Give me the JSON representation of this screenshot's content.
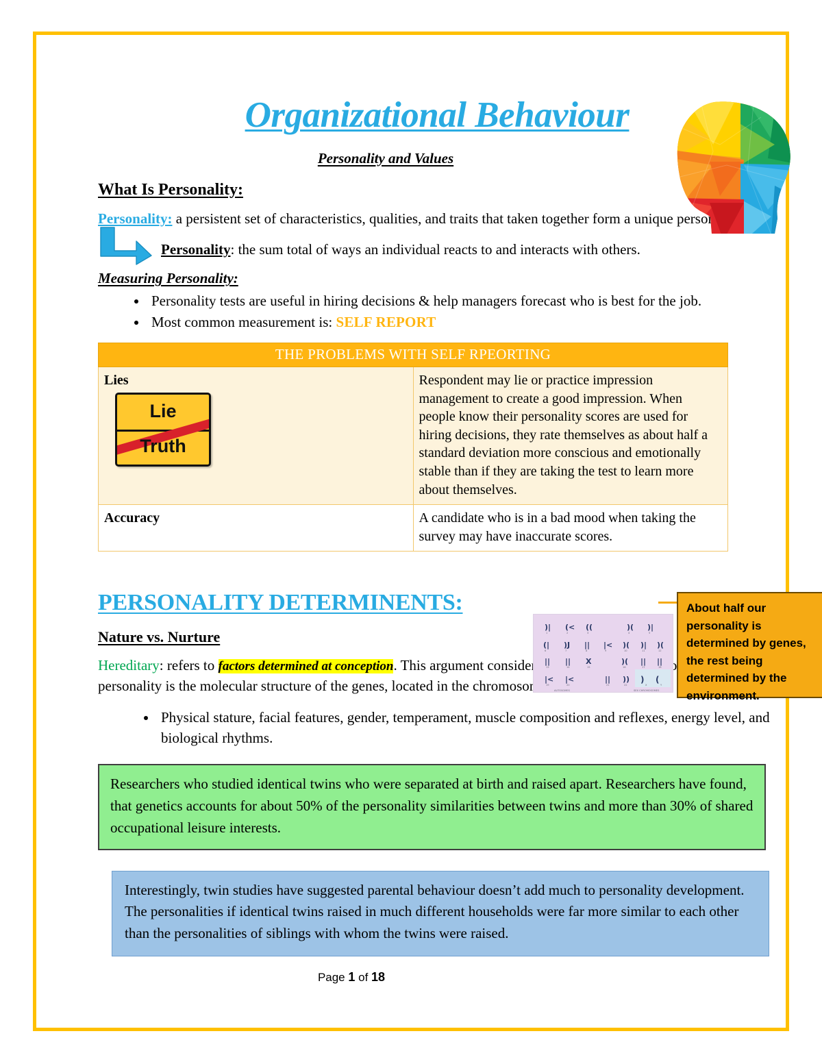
{
  "document": {
    "title": "Organizational Behaviour",
    "subtitle": "Personality and Values",
    "footer_prefix": "Page ",
    "footer_page": "1",
    "footer_middle": " of ",
    "footer_total": "18"
  },
  "colors": {
    "page_border": "#FFC000",
    "title_blue": "#29ABE2",
    "accent_amber": "#FFB511",
    "highlight_yellow": "#FFFF00",
    "green_text": "#00A651",
    "green_box": "#90EE90",
    "blue_box": "#9DC3E6",
    "callout_orange": "#F5AA14",
    "table_header": "#FFB511",
    "table_row_cream": "#FDF3DC"
  },
  "section_personality": {
    "heading": "What Is Personality:",
    "definition_term": "Personality:",
    "definition_text": " a persistent set of characteristics, qualities, and traits that taken together form a unique person.",
    "arrow_term": "Personality",
    "arrow_text": ": the sum total of ways an individual reacts to and interacts with others.",
    "measuring_heading": "Measuring Personality:",
    "bullets": [
      "Personality tests are useful in hiring decisions & help managers forecast who is best for the job."
    ],
    "bullet2_prefix": "Most common measurement is: ",
    "bullet2_emphasis": "SELF REPORT"
  },
  "table_problems": {
    "header": "THE PROBLEMS WITH SELF RPEORTING",
    "rows": [
      {
        "label": "Lies",
        "sign_top": "Lie",
        "sign_bottom": "Truth",
        "body": "Respondent may lie or practice impression management to create a good impression. When people know their personality scores are used for hiring decisions, they rate themselves as about half a standard deviation more conscious and emotionally stable than if they are taking the test to learn more about themselves."
      },
      {
        "label": "Accuracy",
        "body": "A candidate who is in a bad mood when taking the survey may have inaccurate scores."
      }
    ]
  },
  "section_determinants": {
    "heading": "PERSONALITY DETERMINENTS:",
    "nature_heading": "Nature vs. Nurture",
    "hereditary_term": "Hereditary",
    "hereditary_mid": ": refers to ",
    "hereditary_highlight": "factors determined at conception",
    "hereditary_rest": ". This argument considers the ultimate explanation of an individual’s personality is the molecular structure of the genes, located in the chromosomes.",
    "bullets": [
      "Physical stature, facial features, gender, temperament, muscle composition and reflexes, energy level, and biological rhythms."
    ]
  },
  "callout": {
    "text": "About half our personality is determined by genes, the rest being determined by the environment."
  },
  "box_green": {
    "text": "Researchers who studied identical twins who were separated at birth and raised apart. Researchers have found, that genetics accounts for about 50% of the personality similarities between twins and more than 30% of shared occupational leisure interests."
  },
  "box_blue": {
    "text": "Interestingly, twin studies have suggested parental behaviour doesn’t add much to personality development. The personalities if identical twins raised in much different households were far more similar to each other than the personalities of siblings with whom the twins were raised."
  },
  "images": {
    "head": "colorful-low-poly-head-icon",
    "karyotype": "karyotype-chromosomes-image",
    "sign": "lie-truth-road-sign-icon",
    "arrow": "bent-right-arrow-icon"
  }
}
